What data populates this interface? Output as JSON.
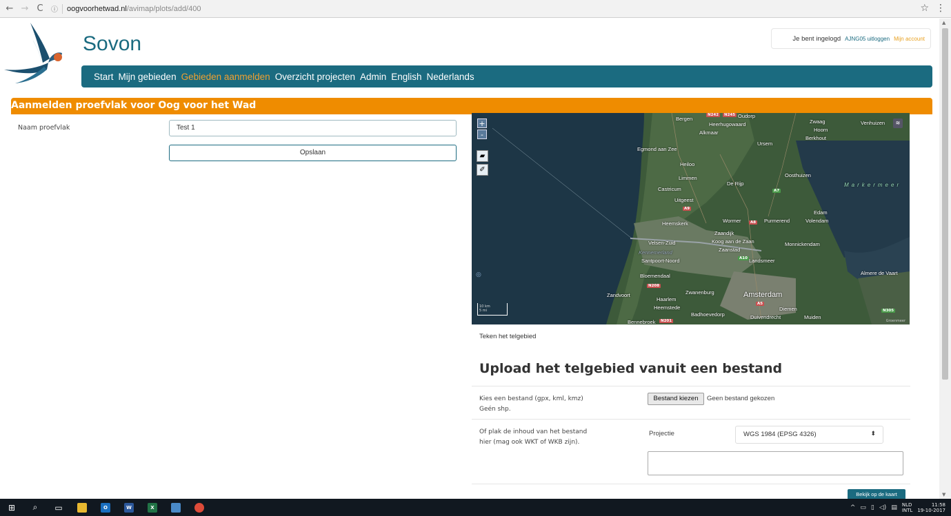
{
  "browser": {
    "url_host": "oogvoorhetwad.nl",
    "url_path": "/avimap/plots/add/400"
  },
  "brand": "Sovon",
  "login": {
    "status": "Je bent ingelogd",
    "logout": "AJNG05 uitloggen",
    "account": "Mijn account"
  },
  "nav": [
    {
      "label": "Start"
    },
    {
      "label": "Mijn gebieden"
    },
    {
      "label": "Gebieden aanmelden"
    },
    {
      "label": "Overzicht projecten"
    },
    {
      "label": "Admin"
    },
    {
      "label": "English"
    },
    {
      "label": "Nederlands"
    }
  ],
  "section_title": "Aanmelden proefvlak voor Oog voor het Wad",
  "form": {
    "name_label": "Naam proefvlak",
    "name_value": "Test 1",
    "save_label": "Opslaan"
  },
  "map": {
    "places": {
      "bergen": "Bergen",
      "oudorp": "Oudorp",
      "heerhugowaard": "Heerhugowaard",
      "alkmaar": "Alkmaar",
      "zwaag": "Zwaag",
      "venhuizen": "Venhuizen",
      "hoorn": "Hoorn",
      "berkhout": "Berkhout",
      "ursem": "Ursem",
      "egmond": "Egmond aan Zee",
      "heiloo": "Heiloo",
      "limmen": "Limmen",
      "oosthuizen": "Oosthuizen",
      "derijp": "De Rijp",
      "castricum": "Castricum",
      "markermeer": "Markermeer",
      "uitgeest": "Uitgeest",
      "edam": "Edam",
      "volendam": "Volendam",
      "heemskerk": "Heemskerk",
      "wormer": "Wormer",
      "purmerend": "Purmerend",
      "zaandijk": "Zaandijk",
      "velsen": "Velsen-Zuid",
      "koog": "Koog aan de Zaan",
      "zaanstad": "Zaanstad",
      "monnickendam": "Monnickendam",
      "kennemerland": "Kennemerland",
      "santpoort": "Santpoort-Noord",
      "landsmeer": "Landsmeer",
      "bloemendaal": "Bloemendaal",
      "almere": "Almere de Vaart",
      "zandvoort": "Zandvoort",
      "zwanenburg": "Zwanenburg",
      "haarlem": "Haarlem",
      "amsterdam": "Amsterdam",
      "heemstede": "Heemstede",
      "diemen": "Diemen",
      "badhoevedorp": "Badhoevedorp",
      "duivendrecht": "Duivendrecht",
      "muiden": "Muiden",
      "bennebroek": "Bennebroek"
    },
    "roads": {
      "n242": "N242",
      "n245": "N245",
      "a9": "A9",
      "a7": "A7",
      "n208": "N208",
      "n201": "N201",
      "a10": "A10",
      "n305": "N305",
      "a8": "A8",
      "a5": "A5"
    },
    "zoom_in": "+",
    "zoom_out": "-",
    "scale_top": "10 km",
    "scale_bottom": "5 mi",
    "attribution": "Groenmeer"
  },
  "draw_caption": "Teken het telgebied",
  "upload": {
    "title": "Upload het telgebied vanuit een bestand",
    "file_label_1": "Kies een bestand (gpx, kml, kmz)",
    "file_label_2": "Geén shp.",
    "file_button": "Bestand kiezen",
    "file_status": "Geen bestand gekozen",
    "paste_label_1": "Of plak de inhoud van het bestand",
    "paste_label_2": "hier (mag ook WKT of WKB zijn).",
    "projection_label": "Projectie",
    "projection_value": "WGS 1984 (EPSG 4326)",
    "view_button": "Bekijk op de kaart"
  },
  "taskbar": {
    "lang_1": "NLD",
    "lang_2": "INTL",
    "time": "11:58",
    "date": "19-10-2017"
  }
}
